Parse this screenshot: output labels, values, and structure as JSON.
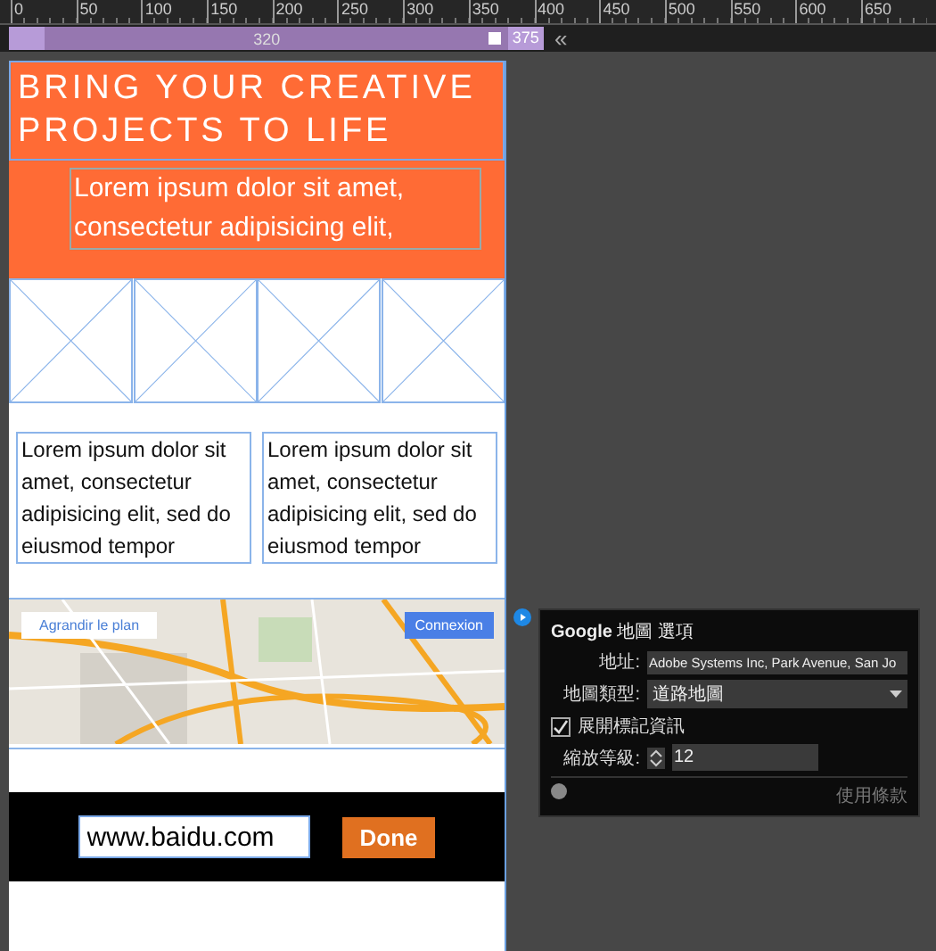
{
  "ruler": {
    "ticks": [
      "0",
      "50",
      "100",
      "150",
      "200",
      "250",
      "300",
      "350",
      "400",
      "450",
      "500",
      "550",
      "600",
      "650"
    ]
  },
  "breakpoint_bar": {
    "width_label": "320",
    "max_label": "375",
    "collapse": "«",
    "level": 0.93
  },
  "hero": {
    "title": "BRING YOUR CREATIVE PROJECTS TO LIFE",
    "text": "Lorem ipsum dolor sit amet, consectetur adipisicing elit,"
  },
  "image_placeholders": [
    {
      "kind": "placeholder"
    },
    {
      "kind": "placeholder"
    },
    {
      "kind": "placeholder"
    },
    {
      "kind": "placeholder"
    }
  ],
  "columns": [
    {
      "text": "Lorem ipsum dolor sit amet, consectetur adipisicing elit, sed do eiusmod tempor"
    },
    {
      "text": "Lorem ipsum dolor sit amet, consectetur adipisicing elit, sed do eiusmod tempor"
    }
  ],
  "map": {
    "kind": "picture",
    "enlarge": "Agrandir le plan",
    "signin": "Connexion"
  },
  "footer": {
    "url_value": "www.baidu.com",
    "done": "Done"
  },
  "map_options": {
    "title_brand": "Google",
    "title": "地圖 選項",
    "address_label": "地址:",
    "address_value": "Adobe Systems Inc, Park Avenue, San Jo",
    "type_label": "地圖類型:",
    "type_value": "道路地圖",
    "expand_label": "展開標記資訊",
    "expand_checked": true,
    "zoom_label": "縮放等級:",
    "zoom_value": "12",
    "terms": "使用條款"
  }
}
